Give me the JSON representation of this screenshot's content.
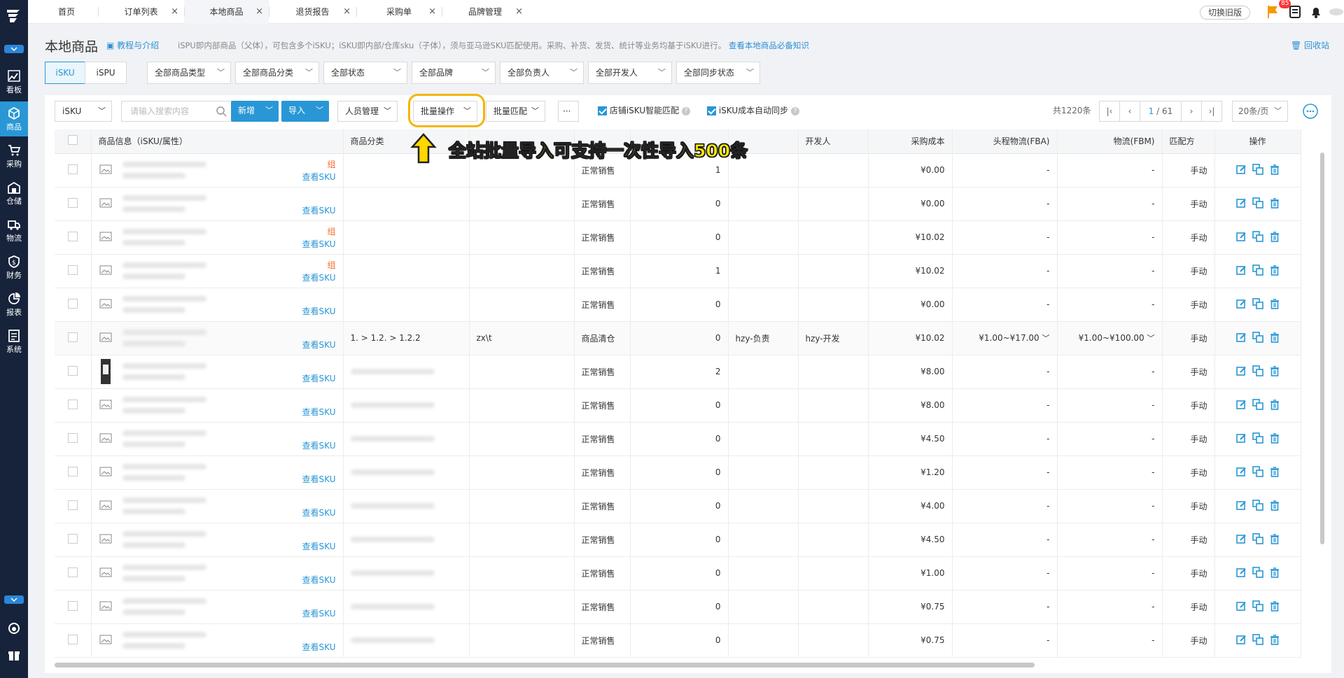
{
  "sidebar": {
    "items": [
      {
        "label": "看板",
        "icon": "chart-icon"
      },
      {
        "label": "商品",
        "icon": "box-icon",
        "active": true
      },
      {
        "label": "采购",
        "icon": "cart-icon"
      },
      {
        "label": "仓储",
        "icon": "warehouse-icon"
      },
      {
        "label": "物流",
        "icon": "truck-icon"
      },
      {
        "label": "财务",
        "icon": "money-icon"
      },
      {
        "label": "报表",
        "icon": "pie-icon"
      },
      {
        "label": "系统",
        "icon": "system-icon"
      }
    ]
  },
  "tabs": [
    {
      "label": "首页",
      "closable": false
    },
    {
      "label": "订单列表",
      "closable": true
    },
    {
      "label": "本地商品",
      "closable": true,
      "active": true
    },
    {
      "label": "退货报告",
      "closable": true
    },
    {
      "label": "采购单",
      "closable": true
    },
    {
      "label": "品牌管理",
      "closable": true
    }
  ],
  "header": {
    "switch_old": "切换旧版",
    "badge": "85"
  },
  "page": {
    "title": "本地商品",
    "tutorial": "教程与介绍",
    "desc": "iSPU即内部商品（父体），可包含多个iSKU；iSKU即内部/仓库sku（子体），须与亚马逊SKU匹配使用。采购、补货、发货、统计等业务均基于iSKU进行。",
    "desc_link": "查看本地商品必备知识",
    "recycle": "回收站"
  },
  "filters": {
    "seg": [
      "iSKU",
      "iSPU"
    ],
    "dropdowns": [
      "全部商品类型",
      "全部商品分类",
      "全部状态",
      "全部品牌",
      "全部负责人",
      "全部开发人",
      "全部同步状态"
    ]
  },
  "toolbar": {
    "search_type": "iSKU",
    "search_placeholder": "请输入搜索内容",
    "new": "新增",
    "import": "导入",
    "staff": "人员管理",
    "batch": "批量操作",
    "batch_match": "批量匹配",
    "more": "···",
    "chk1": "店铺iSKU智能匹配",
    "chk2": "iSKU成本自动同步",
    "total": "共1220条",
    "page_current": "1",
    "page_total": "/ 61",
    "page_size": "20条/页"
  },
  "annotation": "全站批量导入可支持一次性导入500条",
  "table": {
    "headers": [
      "商品信息（iSKU/属性）",
      "商品分类",
      "",
      "",
      "",
      "",
      "开发人",
      "采购成本",
      "头程物流(FBA)",
      "物流(FBM)",
      "匹配方",
      "操作"
    ],
    "rows": [
      {
        "zu": "组",
        "sku": "查看SKU",
        "status": "正常销售",
        "qty": "1",
        "cost": "¥0.00",
        "fba": "-",
        "fbm": "-",
        "match": "手动"
      },
      {
        "zu": "",
        "sku": "查看SKU",
        "status": "正常销售",
        "qty": "0",
        "cost": "¥0.00",
        "fba": "-",
        "fbm": "-",
        "match": "手动"
      },
      {
        "zu": "组",
        "sku": "查看SKU",
        "status": "正常销售",
        "qty": "0",
        "cost": "¥10.02",
        "fba": "-",
        "fbm": "-",
        "match": "手动"
      },
      {
        "zu": "组",
        "sku": "查看SKU",
        "status": "正常销售",
        "qty": "1",
        "cost": "¥10.02",
        "fba": "-",
        "fbm": "-",
        "match": "手动"
      },
      {
        "zu": "",
        "sku": "查看SKU",
        "status": "正常销售",
        "qty": "0",
        "cost": "¥0.00",
        "fba": "-",
        "fbm": "-",
        "match": "手动"
      },
      {
        "zu": "",
        "sku": "查看SKU",
        "cat": "1. > 1.2. > 1.2.2",
        "c3": "zx\\t",
        "status": "商品清仓",
        "qty": "0",
        "owner": "hzy-负责",
        "dev": "hzy-开发",
        "cost": "¥10.02",
        "fba": "¥1.00~¥17.00",
        "fbm": "¥1.00~¥100.00",
        "match": "手动"
      },
      {
        "zu": "",
        "sku": "查看SKU",
        "status": "正常销售",
        "qty": "2",
        "cost": "¥8.00",
        "fba": "-",
        "fbm": "-",
        "match": "手动",
        "photo": true
      },
      {
        "zu": "",
        "sku": "查看SKU",
        "status": "正常销售",
        "qty": "0",
        "cost": "¥8.00",
        "fba": "-",
        "fbm": "-",
        "match": "手动"
      },
      {
        "zu": "",
        "sku": "查看SKU",
        "status": "正常销售",
        "qty": "0",
        "cost": "¥4.50",
        "fba": "-",
        "fbm": "-",
        "match": "手动"
      },
      {
        "zu": "",
        "sku": "查看SKU",
        "status": "正常销售",
        "qty": "0",
        "cost": "¥1.20",
        "fba": "-",
        "fbm": "-",
        "match": "手动"
      },
      {
        "zu": "",
        "sku": "查看SKU",
        "status": "正常销售",
        "qty": "0",
        "cost": "¥4.00",
        "fba": "-",
        "fbm": "-",
        "match": "手动"
      },
      {
        "zu": "",
        "sku": "查看SKU",
        "status": "正常销售",
        "qty": "0",
        "cost": "¥4.50",
        "fba": "-",
        "fbm": "-",
        "match": "手动"
      },
      {
        "zu": "",
        "sku": "查看SKU",
        "status": "正常销售",
        "qty": "0",
        "cost": "¥1.00",
        "fba": "-",
        "fbm": "-",
        "match": "手动"
      },
      {
        "zu": "",
        "sku": "查看SKU",
        "status": "正常销售",
        "qty": "0",
        "cost": "¥0.75",
        "fba": "-",
        "fbm": "-",
        "match": "手动"
      },
      {
        "zu": "",
        "sku": "查看SKU",
        "status": "正常销售",
        "qty": "0",
        "cost": "¥0.75",
        "fba": "-",
        "fbm": "-",
        "match": "手动"
      }
    ]
  },
  "colors": {
    "primary": "#2997d6",
    "sidebar": "#16233b",
    "highlight": "#f6b400",
    "annotation": "#ffe800"
  }
}
